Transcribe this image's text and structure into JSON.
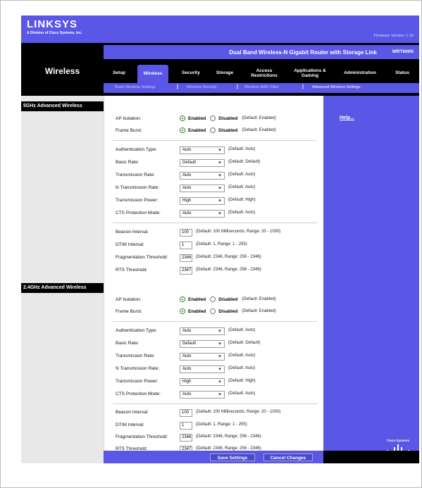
{
  "brand": {
    "name": "LINKSYS",
    "sub": "A Division of Cisco Systems, Inc.",
    "firmware": "Firmware Version: 1.10"
  },
  "product": {
    "name": "Dual Band Wireless-N Gigabit Router with Storage Link",
    "model": "WRT600N"
  },
  "section_title": "Wireless",
  "tabs": [
    {
      "label": "Setup"
    },
    {
      "label": "Wireless"
    },
    {
      "label": "Security"
    },
    {
      "label": "Storage"
    },
    {
      "label": "Access Restrictions"
    },
    {
      "label": "Applications & Gaming"
    },
    {
      "label": "Administration"
    },
    {
      "label": "Status"
    }
  ],
  "subtabs": [
    "Basic Wireless Settings",
    "Wireless Security",
    "Wireless MAC Filter",
    "Advanced Wireless Settings"
  ],
  "help": "Help...",
  "cisco": "Cisco Systems",
  "sections": [
    {
      "title": "5GHz Advanced Wireless",
      "ap_isolation": {
        "label": "AP Isolation:",
        "enabled": "Enabled",
        "disabled": "Disabled",
        "hint": "(Default: Enabled)"
      },
      "frame_burst": {
        "label": "Frame Burst:",
        "enabled": "Enabled",
        "disabled": "Disabled",
        "hint": "(Default: Enabled)"
      },
      "selects": [
        {
          "label": "Authentication Type:",
          "value": "Auto",
          "hint": "(Default: Auto)"
        },
        {
          "label": "Basic Rate:",
          "value": "Default",
          "hint": "(Default: Default)"
        },
        {
          "label": "Transmission Rate:",
          "value": "Auto",
          "hint": "(Default: Auto)"
        },
        {
          "label": "N Transmission Rate:",
          "value": "Auto",
          "hint": "(Default: Auto)"
        },
        {
          "label": "Transmission Power:",
          "value": "High",
          "hint": "(Default: High)"
        },
        {
          "label": "CTS Protection Mode:",
          "value": "Auto",
          "hint": "(Default: Auto)"
        }
      ],
      "inputs": [
        {
          "label": "Beacon Interval:",
          "value": "100",
          "hint": "(Default: 100 Milliseconds, Range: 20 - 1000)"
        },
        {
          "label": "DTIM Interval:",
          "value": "1",
          "hint": "(Default: 1, Range: 1 - 255)"
        },
        {
          "label": "Fragmentation Threshold:",
          "value": "2346",
          "hint": "(Default: 2346, Range: 256 - 2346)"
        },
        {
          "label": "RTS Threshold:",
          "value": "2347",
          "hint": "(Default: 2346, Range: 256 - 2346)"
        }
      ]
    },
    {
      "title": "2.4GHz Advanced Wireless",
      "ap_isolation": {
        "label": "AP Isolation:",
        "enabled": "Enabled",
        "disabled": "Disabled",
        "hint": "(Default: Enabled)"
      },
      "frame_burst": {
        "label": "Frame Burst:",
        "enabled": "Enabled",
        "disabled": "Disabled",
        "hint": "(Default: Enabled)"
      },
      "selects": [
        {
          "label": "Authentication Type:",
          "value": "Auto",
          "hint": "(Default: Auto)"
        },
        {
          "label": "Basic Rate:",
          "value": "Default",
          "hint": "(Default: Default)"
        },
        {
          "label": "Transmission Rate:",
          "value": "Auto",
          "hint": "(Default: Auto)"
        },
        {
          "label": "N Transmission Rate:",
          "value": "Auto",
          "hint": "(Default: Auto)"
        },
        {
          "label": "Transmission Power:",
          "value": "High",
          "hint": "(Default: High)"
        },
        {
          "label": "CTS Protection Mode:",
          "value": "Auto",
          "hint": "(Default: Auto)"
        }
      ],
      "inputs": [
        {
          "label": "Beacon Interval:",
          "value": "100",
          "hint": "(Default: 100 Milliseconds, Range: 20 - 1000)"
        },
        {
          "label": "DTIM Interval:",
          "value": "1",
          "hint": "(Default: 1, Range: 1 - 255)"
        },
        {
          "label": "Fragmentation Threshold:",
          "value": "2346",
          "hint": "(Default: 2346, Range: 256 - 2346)"
        },
        {
          "label": "RTS Threshold:",
          "value": "2347",
          "hint": "(Default: 2346, Range: 256 - 2346)"
        }
      ]
    }
  ],
  "buttons": {
    "save": "Save Settings",
    "cancel": "Cancel Changes"
  },
  "colors": {
    "accent": "#5a56e6",
    "bar": "#000000",
    "enabled_radio": "#2a8a2a"
  }
}
